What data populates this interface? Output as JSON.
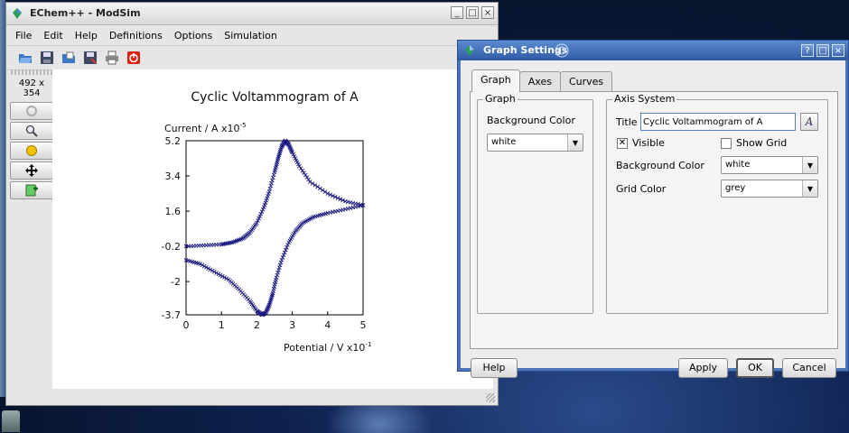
{
  "main_window": {
    "title": "EChem++ - ModSim",
    "menu": [
      "File",
      "Edit",
      "Help",
      "Definitions",
      "Options",
      "Simulation"
    ],
    "size_label": "492 x 354"
  },
  "chart_data": {
    "type": "scatter",
    "title": "Cyclic Voltammogram of A",
    "ylabel": "Current / A x10",
    "ylabel_exp": "-5",
    "xlabel": "Potential / V x10",
    "xlabel_exp": "-1",
    "xlim": [
      0,
      5
    ],
    "ylim": [
      -3.7,
      5.2
    ],
    "xticks": [
      "0",
      "1",
      "2",
      "3",
      "4",
      "5"
    ],
    "yticks": [
      "5.2",
      "3.4",
      "1.6",
      "-0.2",
      "-2",
      "-3.7"
    ],
    "ytick_values": [
      5.2,
      3.4,
      1.6,
      -0.2,
      -2,
      -3.7
    ],
    "grid": false,
    "color": "#1a1a80",
    "series": [
      {
        "x": [
          0.0,
          0.5,
          1.0,
          1.3,
          1.6,
          1.8,
          2.0,
          2.2,
          2.35,
          2.5,
          2.6,
          2.7,
          2.8,
          2.9,
          3.0,
          3.2,
          3.5,
          4.0,
          4.5,
          5.0
        ],
        "values": [
          -0.2,
          -0.15,
          -0.1,
          0.0,
          0.2,
          0.5,
          1.0,
          1.8,
          2.6,
          3.6,
          4.3,
          4.9,
          5.2,
          5.0,
          4.6,
          3.9,
          3.1,
          2.5,
          2.1,
          1.9
        ]
      },
      {
        "x": [
          5.0,
          4.5,
          4.0,
          3.6,
          3.3,
          3.1,
          2.9,
          2.7,
          2.55,
          2.45,
          2.35,
          2.25,
          2.15,
          2.0,
          1.8,
          1.5,
          1.2,
          0.8,
          0.4,
          0.0
        ],
        "values": [
          1.9,
          1.7,
          1.5,
          1.3,
          1.0,
          0.6,
          0.0,
          -0.9,
          -1.8,
          -2.6,
          -3.2,
          -3.6,
          -3.7,
          -3.5,
          -3.0,
          -2.4,
          -1.9,
          -1.5,
          -1.1,
          -0.9
        ]
      }
    ]
  },
  "dialog": {
    "title": "Graph Settings",
    "tabs": [
      "Graph",
      "Axes",
      "Curves"
    ],
    "graph_group": {
      "title": "Graph",
      "bg_label": "Background Color",
      "bg_value": "white"
    },
    "axis_group": {
      "title": "Axis System",
      "title_label": "Title",
      "title_value": "Cyclic Voltammogram of A",
      "visible_label": "Visible",
      "visible_checked": true,
      "show_grid_label": "Show Grid",
      "show_grid_checked": false,
      "bg_label": "Background Color",
      "bg_value": "white",
      "grid_color_label": "Grid Color",
      "grid_color_value": "grey"
    },
    "buttons": {
      "help": "Help",
      "apply": "Apply",
      "ok": "OK",
      "cancel": "Cancel"
    }
  },
  "colors": {
    "active_titlebar": "#2f5aa3",
    "curve": "#1a1a80"
  }
}
